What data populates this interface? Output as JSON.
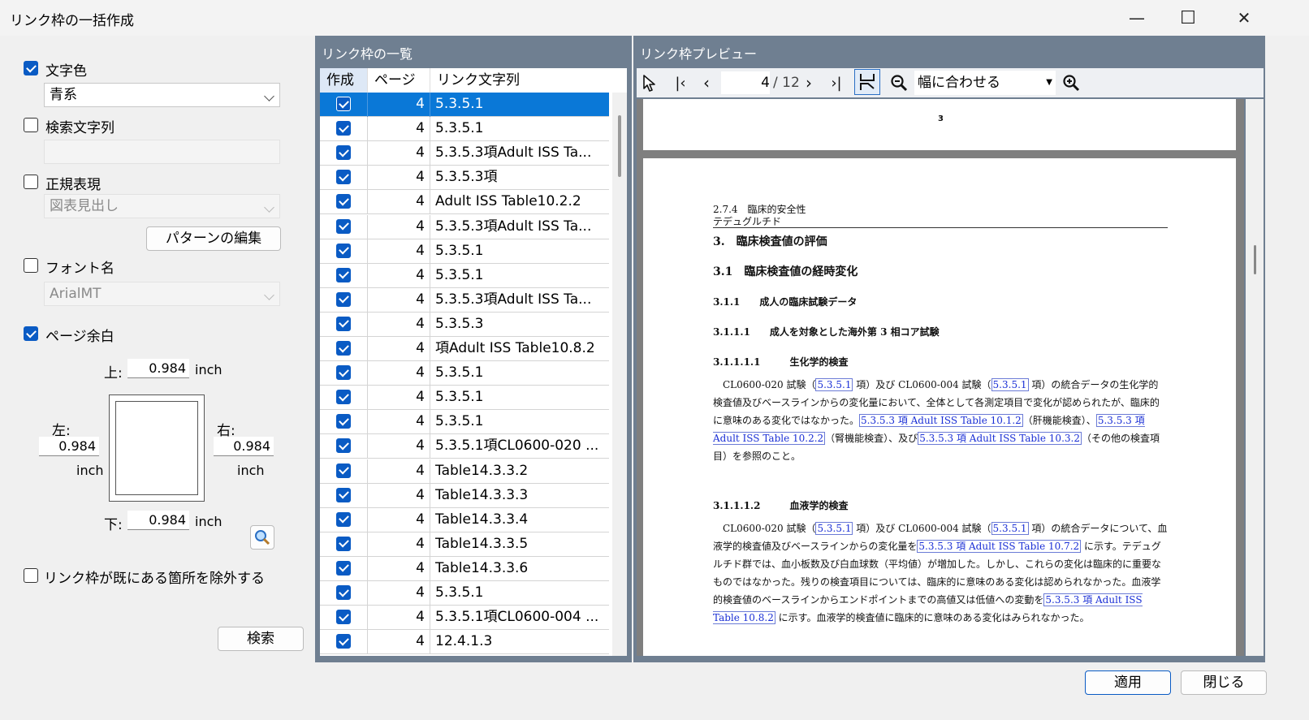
{
  "window": {
    "title": "リンク枠の一括作成",
    "minimize": "—",
    "maximize": "☐",
    "close": "✕"
  },
  "options": {
    "text_color": {
      "label": "文字色",
      "checked": true,
      "value": "青系"
    },
    "search_string": {
      "label": "検索文字列",
      "checked": false,
      "value": ""
    },
    "regex": {
      "label": "正規表現",
      "checked": false,
      "value": "図表見出し",
      "edit_button": "パターンの編集"
    },
    "font_name": {
      "label": "フォント名",
      "checked": false,
      "value": "ArialMT"
    },
    "page_margin": {
      "label": "ページ余白",
      "checked": true,
      "top_label": "上:",
      "top": "0.984",
      "left_label": "左:",
      "left": "0.984",
      "right_label": "右:",
      "right": "0.984",
      "bottom_label": "下:",
      "bottom": "0.984",
      "unit": "inch"
    },
    "exclude_existing": {
      "label": "リンク枠が既にある箇所を除外する",
      "checked": false
    },
    "search_button": "検索"
  },
  "list_panel": {
    "title": "リンク枠の一覧",
    "columns": [
      "作成",
      "ページ",
      "リンク文字列"
    ],
    "rows": [
      {
        "checked": true,
        "page": "4",
        "text": "5.3.5.1",
        "selected": true
      },
      {
        "checked": true,
        "page": "4",
        "text": "5.3.5.1"
      },
      {
        "checked": true,
        "page": "4",
        "text": "5.3.5.3項Adult ISS Ta..."
      },
      {
        "checked": true,
        "page": "4",
        "text": "5.3.5.3項"
      },
      {
        "checked": true,
        "page": "4",
        "text": "Adult ISS Table10.2.2"
      },
      {
        "checked": true,
        "page": "4",
        "text": "5.3.5.3項Adult ISS Ta..."
      },
      {
        "checked": true,
        "page": "4",
        "text": "5.3.5.1"
      },
      {
        "checked": true,
        "page": "4",
        "text": "5.3.5.1"
      },
      {
        "checked": true,
        "page": "4",
        "text": "5.3.5.3項Adult ISS Ta..."
      },
      {
        "checked": true,
        "page": "4",
        "text": "5.3.5.3"
      },
      {
        "checked": true,
        "page": "4",
        "text": "項Adult ISS Table10.8.2"
      },
      {
        "checked": true,
        "page": "4",
        "text": "5.3.5.1"
      },
      {
        "checked": true,
        "page": "4",
        "text": "5.3.5.1"
      },
      {
        "checked": true,
        "page": "4",
        "text": "5.3.5.1"
      },
      {
        "checked": true,
        "page": "4",
        "text": "5.3.5.1項CL0600-020 ..."
      },
      {
        "checked": true,
        "page": "4",
        "text": "Table14.3.3.2"
      },
      {
        "checked": true,
        "page": "4",
        "text": "Table14.3.3.3"
      },
      {
        "checked": true,
        "page": "4",
        "text": "Table14.3.3.4"
      },
      {
        "checked": true,
        "page": "4",
        "text": "Table14.3.3.5"
      },
      {
        "checked": true,
        "page": "4",
        "text": "Table14.3.3.6"
      },
      {
        "checked": true,
        "page": "4",
        "text": "5.3.5.1"
      },
      {
        "checked": true,
        "page": "4",
        "text": "5.3.5.1項CL0600-004 ..."
      },
      {
        "checked": true,
        "page": "4",
        "text": "12.4.1.3"
      }
    ]
  },
  "preview_panel": {
    "title": "リンク枠プレビュー",
    "page_current": "4",
    "page_total": "/ 12",
    "zoom_mode": "幅に合わせる",
    "prev_page_number": "3",
    "doc": {
      "header1": "2.7.4　臨床的安全性",
      "header2": "テデュグルチド",
      "h1": "3.　臨床検査値の評価",
      "h2": "3.1　臨床検査値の経時変化",
      "h3": "3.1.1　　成人の臨床試験データ",
      "h4": "3.1.1.1　　成人を対象とした海外第 3 相コア試験",
      "h5a": "3.1.1.1.1　　　生化学的検査",
      "p1_a": "CL0600-020 試験（",
      "p1_l1": "5.3.5.1",
      "p1_b": " 項）及び CL0600-004 試験（",
      "p1_l2": "5.3.5.1",
      "p1_c": " 項）の統合データの生化学的検査値及びベースラインからの変化量において、全体として各測定項目で変化が認められたが、臨床的に意味のある変化ではなかった。",
      "p1_l3": "5.3.5.3 項 Adult ISS Table 10.1.2",
      "p1_d": "（肝機能検査）、",
      "p1_l4": "5.3.5.3 項 Adult ISS Table 10.2.2",
      "p1_e": "（腎機能検査）、及び",
      "p1_l5": "5.3.5.3 項 Adult ISS Table 10.3.2",
      "p1_f": "（その他の検査項目）を参照のこと。",
      "h5b": "3.1.1.1.2　　　血液学的検査",
      "p2_a": "CL0600-020 試験（",
      "p2_l1": "5.3.5.1",
      "p2_b": " 項）及び CL0600-004 試験（",
      "p2_l2": "5.3.5.1",
      "p2_c": " 項）の統合データについて、血液学的検査値及びベースラインからの変化量を",
      "p2_l3": "5.3.5.3 項 Adult ISS Table 10.7.2",
      "p2_d": " に示す。テデュグルチド群では、血小板数及び白血球数（平均値）が増加した。しかし、これらの変化は臨床的に重要なものではなかった。残りの検査項目については、臨床的に意味のある変化は認められなかった。血液学的検査値のベースラインからエンドポイントまでの高値又は低値への変動を",
      "p2_l4": "5.3.5.3 項 Adult ISS Table 10.8.2",
      "p2_e": " に示す。血液学的検査値に臨床的に意味のある変化はみられなかった。"
    }
  },
  "footer": {
    "apply": "適用",
    "close": "閉じる"
  },
  "colors": {
    "accent": "#0a5bc4",
    "panel_header": "#6f7f91",
    "selected_row": "#0a78d7",
    "link": "#1a2fd6"
  }
}
